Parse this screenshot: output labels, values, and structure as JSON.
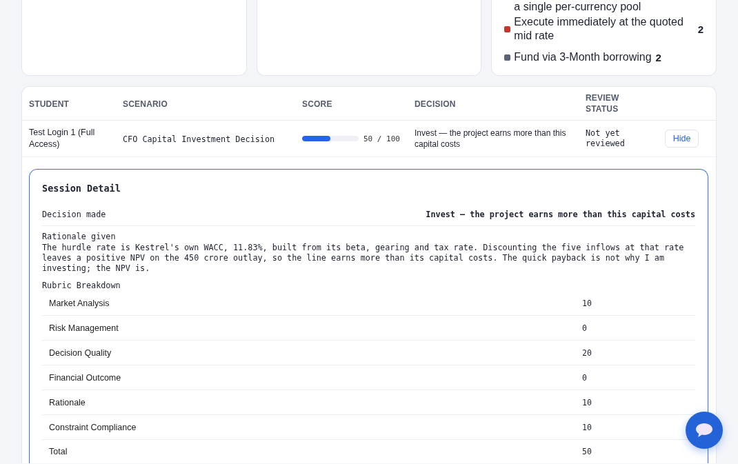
{
  "summary_cards": [
    {
      "kind": "blank"
    },
    {
      "kind": "blank"
    },
    {
      "kind": "legend",
      "clipped_line": "a single per-currency pool",
      "legend": [
        {
          "text": "Execute immediately at the quoted mid rate",
          "count": "2",
          "color": "#c9372c"
        },
        {
          "text": "Fund via 3-Month borrowing",
          "count": "2",
          "color": "#5b6377"
        }
      ]
    }
  ],
  "sessions_table": {
    "columns": [
      "STUDENT",
      "SCENARIO",
      "SCORE",
      "DECISION",
      "REVIEW STATUS"
    ],
    "rows": [
      {
        "student": "Test Login 1 (Full Access)",
        "scenario": "CFO Capital Investment Decision",
        "score": {
          "level": 0.5,
          "text": "50 / 100"
        },
        "decision": "Invest — the project earns more than this capital costs",
        "review_status": "Not yet reviewed",
        "action": "Hide",
        "expanded": true,
        "detail": {
          "title": "Session Detail",
          "decision_label": "Decision made",
          "decision_value": "Invest — the project earns more than this capital costs",
          "rationale_label": "Rationale given",
          "rationale": "The hurdle rate is Kestrel's own WACC, 11.83%, built from its beta, gearing and tax rate. Discounting the five inflows at that rate leaves a positive NPV on the 450 crore outlay, so the line earns more than its capital costs. The quick payback is not why I am investing; the NPV is.",
          "rubric_title": "Rubric Breakdown",
          "rubric": [
            {
              "criterion": "Market Analysis",
              "points": "10"
            },
            {
              "criterion": "Risk Management",
              "points": "0"
            },
            {
              "criterion": "Decision Quality",
              "points": "20"
            },
            {
              "criterion": "Financial Outcome",
              "points": "0"
            },
            {
              "criterion": "Rationale",
              "points": "10"
            },
            {
              "criterion": "Constraint Compliance",
              "points": "10"
            },
            {
              "criterion": "Total",
              "points": "50"
            }
          ]
        }
      }
    ]
  }
}
